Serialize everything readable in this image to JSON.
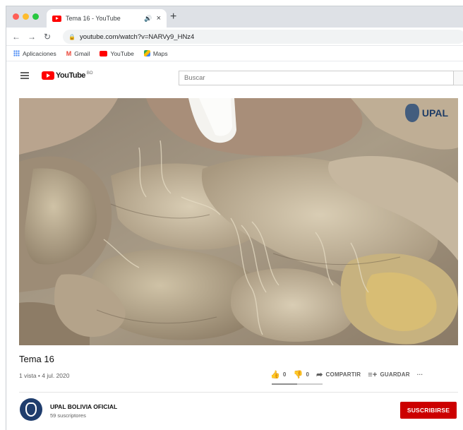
{
  "browser": {
    "tab_title": "Tema 16 - YouTube",
    "tab_audio_icon": "speaker-icon",
    "url": "youtube.com/watch?v=NARVy9_HNz4",
    "bookmarks": [
      {
        "label": "Aplicaciones",
        "icon": "apps-grid-icon"
      },
      {
        "label": "Gmail",
        "icon": "gmail-icon"
      },
      {
        "label": "YouTube",
        "icon": "youtube-icon"
      },
      {
        "label": "Maps",
        "icon": "maps-icon"
      }
    ]
  },
  "youtube": {
    "logo_text": "YouTube",
    "logo_country": "BO",
    "search_placeholder": "Buscar"
  },
  "video": {
    "watermark": "UPAL",
    "title": "Tema 16",
    "meta": "1 vista • 4 jul. 2020",
    "likes": "0",
    "dislikes": "0",
    "like_ratio": 0.5,
    "share_label": "COMPARTIR",
    "save_label": "GUARDAR",
    "more_label": "···"
  },
  "channel": {
    "name": "UPAL BOLIVIA OFICIAL",
    "subscribers": "59 suscriptores",
    "subscribe_label": "SUSCRIBIRSE"
  },
  "colors": {
    "accent": "#cc0000",
    "youtube_red": "#ff0000",
    "channel_blue": "#1f3d6d"
  }
}
